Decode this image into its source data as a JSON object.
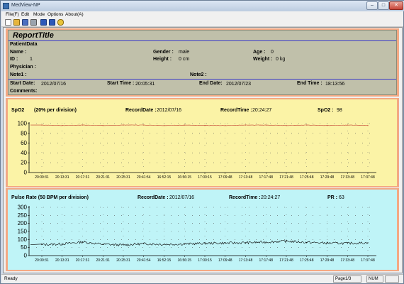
{
  "window": {
    "title": "MedView-NP",
    "min_label": "–",
    "max_label": "□",
    "close_label": "✕"
  },
  "menu": [
    "File(F)",
    "Edit",
    "Mode",
    "Options",
    "About(A)"
  ],
  "toolbar": [
    "new-icon",
    "open-icon",
    "save-icon",
    "print-icon",
    "prev-icon",
    "next-icon",
    "help-icon"
  ],
  "report": {
    "title": "ReportTitle",
    "section": "PatientData",
    "name_label": "Name :",
    "name_value": "",
    "gender_label": "Gender :",
    "gender_value": "male",
    "age_label": "Age :",
    "age_value": "0",
    "id_label": "ID :",
    "id_value": "1",
    "height_label": "Height :",
    "height_value": "0 cm",
    "weight_label": "Weight :",
    "weight_value": "0 kg",
    "physician_label": "Physician :",
    "note1_label": "Note1 :",
    "note2_label": "Note2 :",
    "start_date_label": "Start Date:",
    "start_date_value": "2012/07/16",
    "start_time_label": "Start Time :",
    "start_time_value": "20:05:31",
    "end_date_label": "End Date:",
    "end_date_value": "2012/07/23",
    "end_time_label": "End Time :",
    "end_time_value": "18:13:56",
    "comments_label": "Comments:"
  },
  "spo2": {
    "title": "SpO2",
    "division": "(20% per division)",
    "record_date_label": "RecordDate :",
    "record_date_value": "2012/07/16",
    "record_time_label": "RecordTime :",
    "record_time_value": "20:24:27",
    "reading_label": "SpO2 :",
    "reading_value": "98"
  },
  "pulse": {
    "title": "Pulse Rate (50 BPM per division)",
    "record_date_label": "RecordDate :",
    "record_date_value": "2012/07/16",
    "record_time_label": "RecordTime :",
    "record_time_value": "20:24:27",
    "reading_label": "PR :",
    "reading_value": "63"
  },
  "chart_data": [
    {
      "type": "line",
      "name": "SpO2",
      "ylim": [
        0,
        100
      ],
      "yticks": [
        0,
        20,
        40,
        60,
        80,
        100
      ],
      "x": [
        "20:09:31",
        "20:13:31",
        "20:17:31",
        "20:21:31",
        "20:25:31",
        "20:41:54",
        "16:52:15",
        "16:56:15",
        "17:00:15",
        "17:09:48",
        "17:13:48",
        "17:17:48",
        "17:21:48",
        "17:25:48",
        "17:29:48",
        "17:33:48",
        "17:37:48"
      ],
      "values": [
        97,
        96,
        97,
        96,
        97,
        97,
        96,
        97,
        96,
        96,
        97,
        97,
        96,
        97,
        96,
        97,
        96
      ],
      "color": "#c0392b",
      "grid": true
    },
    {
      "type": "line",
      "name": "Pulse Rate",
      "ylim": [
        0,
        300
      ],
      "yticks": [
        0,
        50,
        100,
        150,
        200,
        250,
        300
      ],
      "x": [
        "20:09:31",
        "20:13:31",
        "20:17:31",
        "20:21:31",
        "20:25:31",
        "20:41:54",
        "16:52:15",
        "16:56:15",
        "17:00:15",
        "17:09:48",
        "17:13:48",
        "17:17:48",
        "17:21:48",
        "17:25:48",
        "17:29:48",
        "17:33:48",
        "17:37:48"
      ],
      "values": [
        68,
        72,
        85,
        70,
        66,
        74,
        70,
        72,
        76,
        78,
        80,
        84,
        90,
        82,
        78,
        76,
        80
      ],
      "color": "#000000",
      "grid": true
    }
  ],
  "status": {
    "text": "Ready",
    "page": "Page1/3",
    "num": "NUM"
  }
}
